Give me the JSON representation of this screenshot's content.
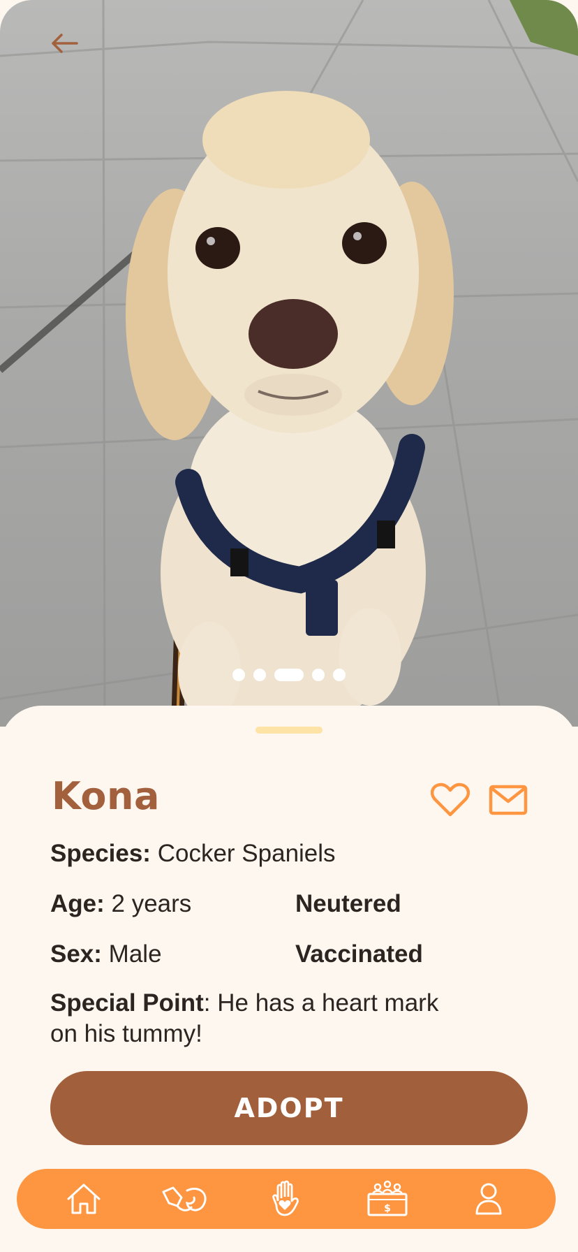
{
  "app": {
    "accent": "#fd9541",
    "brand_brown": "#a2603d",
    "button_brown": "#a15f3c",
    "sheet_bg": "#fef7f0"
  },
  "gallery": {
    "back_icon": "arrow-left-icon",
    "total_images": 5,
    "active_index": 2
  },
  "pet": {
    "name": "Kona",
    "species_label": "Species:",
    "species_value": "Cocker Spaniels",
    "age_label": "Age:",
    "age_value": "2 years",
    "sex_label": "Sex:",
    "sex_value": "Male",
    "tag_neutered": "Neutered",
    "tag_vaccinated": "Vaccinated",
    "special_label": "Special Point",
    "special_value": ": He has a heart mark on his tummy!"
  },
  "actions": {
    "favorite_icon": "heart-icon",
    "message_icon": "mail-icon",
    "adopt_label": "ADOPT"
  },
  "nav": {
    "items": [
      {
        "icon": "home-icon"
      },
      {
        "icon": "hand-paw-icon"
      },
      {
        "icon": "raised-hand-heart-icon"
      },
      {
        "icon": "donation-box-icon"
      },
      {
        "icon": "profile-icon"
      }
    ]
  }
}
